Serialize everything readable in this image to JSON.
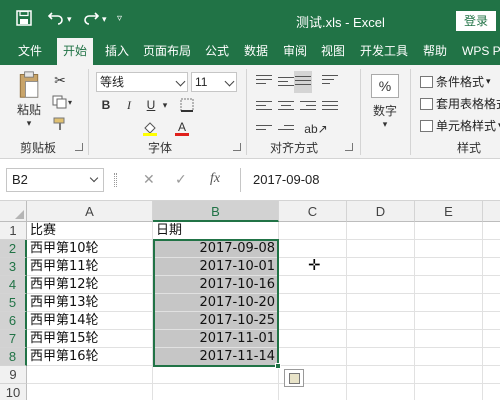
{
  "window": {
    "document_title": "测试.xls - Excel",
    "login_label": "登录"
  },
  "quick_access": {
    "save_icon": "save-icon",
    "undo_icon": "undo-icon",
    "redo_icon": "redo-icon",
    "customize_icon": "chevron-down-icon"
  },
  "ribbon_tabs": [
    "文件",
    "开始",
    "插入",
    "页面布局",
    "公式",
    "数据",
    "审阅",
    "视图",
    "开发工具",
    "帮助",
    "WPS PI"
  ],
  "active_tab": "开始",
  "ribbon": {
    "clipboard": {
      "paste_label": "粘贴",
      "group_label": "剪贴板"
    },
    "font": {
      "font_name": "等线",
      "font_size": "11",
      "bold": "B",
      "italic": "I",
      "underline": "U",
      "font_color_letter": "A",
      "group_label": "字体"
    },
    "alignment": {
      "group_label": "对齐方式"
    },
    "number": {
      "percent": "%",
      "label": "数字"
    },
    "styles": {
      "conditional_format": "条件格式",
      "table_format": "套用表格格式",
      "cell_style": "单元格样式",
      "group_label": "样式"
    }
  },
  "formula_bar": {
    "name_box": "B2",
    "fx_label": "fx",
    "content": "2017-09-08"
  },
  "sheet": {
    "columns": [
      "A",
      "B",
      "C",
      "D",
      "E"
    ],
    "selected_column": "B",
    "rows": [
      {
        "n": "1",
        "a": "比赛",
        "b": "日期"
      },
      {
        "n": "2",
        "a": "西甲第10轮",
        "b": "2017-09-08"
      },
      {
        "n": "3",
        "a": "西甲第11轮",
        "b": "2017-10-01"
      },
      {
        "n": "4",
        "a": "西甲第12轮",
        "b": "2017-10-16"
      },
      {
        "n": "5",
        "a": "西甲第13轮",
        "b": "2017-10-20"
      },
      {
        "n": "6",
        "a": "西甲第14轮",
        "b": "2017-10-25"
      },
      {
        "n": "7",
        "a": "西甲第15轮",
        "b": "2017-11-01"
      },
      {
        "n": "8",
        "a": "西甲第16轮",
        "b": "2017-11-14"
      },
      {
        "n": "9",
        "a": "",
        "b": ""
      },
      {
        "n": "10",
        "a": "",
        "b": ""
      }
    ],
    "selected_range": "B2:B8"
  },
  "colors": {
    "excel_green": "#217346",
    "selection_fill": "#c6c6c6"
  }
}
